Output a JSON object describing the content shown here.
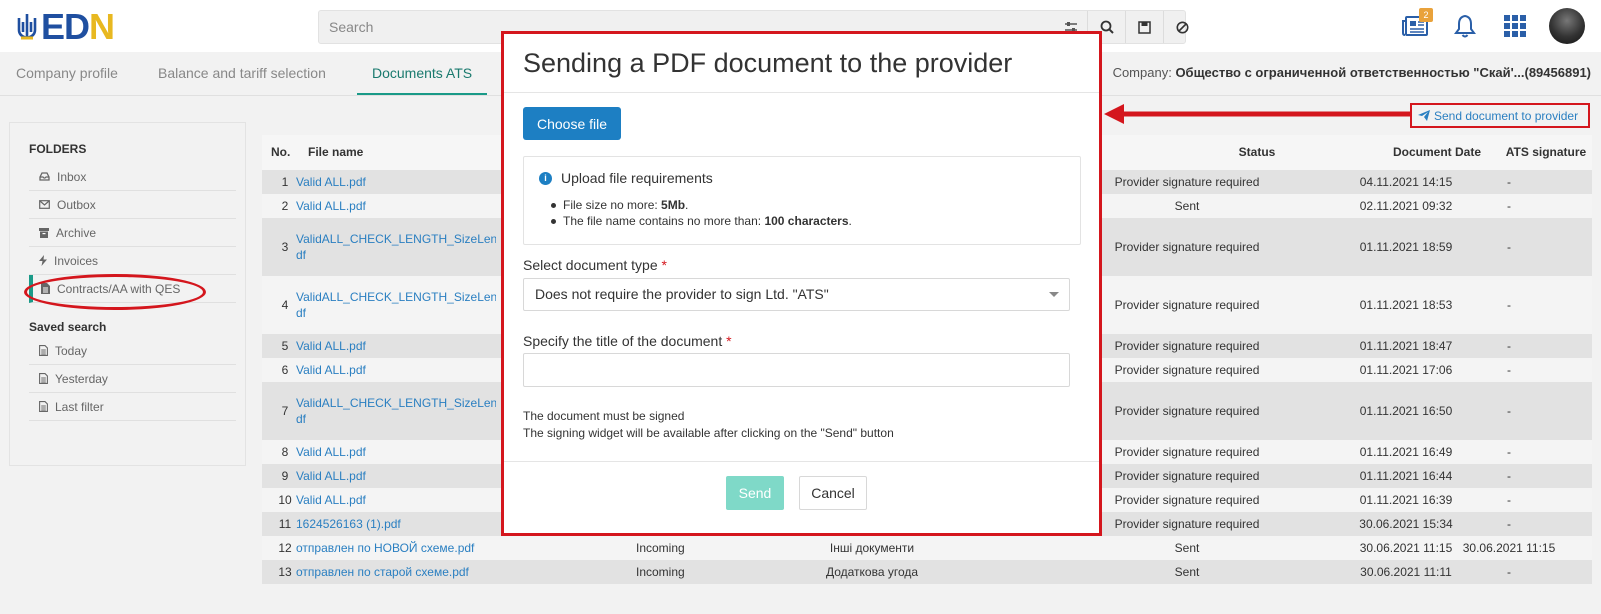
{
  "logo": {
    "letters": [
      "E",
      "D",
      "N"
    ]
  },
  "header": {
    "search_placeholder": "Search",
    "notification_badge": "2"
  },
  "tabs": [
    {
      "label": "Company profile"
    },
    {
      "label": "Balance and tariff selection"
    },
    {
      "label": "Documents ATS"
    }
  ],
  "company": {
    "prefix": "Company:",
    "name": "Общество с ограниченной ответственностью \"Скай'...(89456891)"
  },
  "send_to_provider_label": "Send document to provider",
  "sidebar": {
    "folders_heading": "FOLDERS",
    "folders": [
      {
        "label": "Inbox",
        "icon": "inbox-icon"
      },
      {
        "label": "Outbox",
        "icon": "envelope-icon"
      },
      {
        "label": "Archive",
        "icon": "archive-icon"
      },
      {
        "label": "Invoices",
        "icon": "bolt-icon"
      },
      {
        "label": "Contracts/AA with QES",
        "icon": "document-icon"
      }
    ],
    "saved_heading": "Saved search",
    "saved": [
      {
        "label": "Today"
      },
      {
        "label": "Yesterday"
      },
      {
        "label": "Last filter"
      }
    ]
  },
  "table": {
    "headers": {
      "no": "No.",
      "file": "File name",
      "status": "Status",
      "date": "Document Date",
      "sig": "ATS signature"
    },
    "rows": [
      {
        "no": "1",
        "file": "Valid ALL.pdf",
        "dir": "",
        "type": "",
        "status": "Provider signature required",
        "date": "04.11.2021 14:15",
        "sig": "-"
      },
      {
        "no": "2",
        "file": "Valid ALL.pdf",
        "dir": "",
        "type": "",
        "status": "Sent",
        "date": "02.11.2021 09:32",
        "sig": "-"
      },
      {
        "no": "3",
        "file": "ValidALL_CHECK_LENGTH_SizeLengthLengthLengthLengthLengt\ndf",
        "dir": "",
        "type": "",
        "status": "Provider signature required",
        "date": "01.11.2021 18:59",
        "sig": "-"
      },
      {
        "no": "4",
        "file": "ValidALL_CHECK_LENGTH_SizeLengthLengthLengthLengthLengt\ndf",
        "dir": "",
        "type": "",
        "status": "Provider signature required",
        "date": "01.11.2021 18:53",
        "sig": "-"
      },
      {
        "no": "5",
        "file": "Valid ALL.pdf",
        "dir": "",
        "type": "",
        "status": "Provider signature required",
        "date": "01.11.2021 18:47",
        "sig": "-"
      },
      {
        "no": "6",
        "file": "Valid ALL.pdf",
        "dir": "",
        "type": "",
        "status": "Provider signature required",
        "date": "01.11.2021 17:06",
        "sig": "-"
      },
      {
        "no": "7",
        "file": "ValidALL_CHECK_LENGTH_SizeLengthLengthLengthLengthLengt\ndf",
        "dir": "",
        "type": "",
        "status": "Provider signature required",
        "date": "01.11.2021 16:50",
        "sig": "-"
      },
      {
        "no": "8",
        "file": "Valid ALL.pdf",
        "dir": "",
        "type": "",
        "status": "Provider signature required",
        "date": "01.11.2021 16:49",
        "sig": "-"
      },
      {
        "no": "9",
        "file": "Valid ALL.pdf",
        "dir": "",
        "type": "",
        "status": "Provider signature required",
        "date": "01.11.2021 16:44",
        "sig": "-"
      },
      {
        "no": "10",
        "file": "Valid ALL.pdf",
        "dir": "",
        "type": "",
        "status": "Provider signature required",
        "date": "01.11.2021 16:39",
        "sig": "-"
      },
      {
        "no": "11",
        "file": "1624526163 (1).pdf",
        "dir": "",
        "type": "",
        "status": "Provider signature required",
        "date": "30.06.2021 15:34",
        "sig": "-"
      },
      {
        "no": "12",
        "file": "отправлен по НОВОЙ схеме.pdf",
        "dir": "Incoming",
        "type": "Інші документи",
        "status": "Sent",
        "date": "30.06.2021 11:15",
        "sig": "30.06.2021 11:15"
      },
      {
        "no": "13",
        "file": "отправлен по старой схеме.pdf",
        "dir": "Incoming",
        "type": "Додаткова угода",
        "status": "Sent",
        "date": "30.06.2021 11:11",
        "sig": "-"
      }
    ]
  },
  "modal": {
    "title": "Sending a PDF document to the provider",
    "choose_file": "Choose file",
    "req_title": "Upload file requirements",
    "req1_text": "File size no more: ",
    "req1_bold": "5Mb",
    "req2_text": "The file name contains no more than: ",
    "req2_bold": "100 characters",
    "doc_type_label": "Select document type",
    "doc_type_value": "Does not require the provider to sign Ltd. \"ATS\"",
    "title_label": "Specify the title of the document",
    "title_value": "",
    "note1": "The document must be signed",
    "note2": "The signing widget will be available after clicking on the \"Send\" button",
    "send": "Send",
    "cancel": "Cancel"
  },
  "colors": {
    "accent": "#1a9a88",
    "link": "#2a7fc1",
    "annotation": "#d4161d",
    "primary_button": "#1d7fc3"
  }
}
